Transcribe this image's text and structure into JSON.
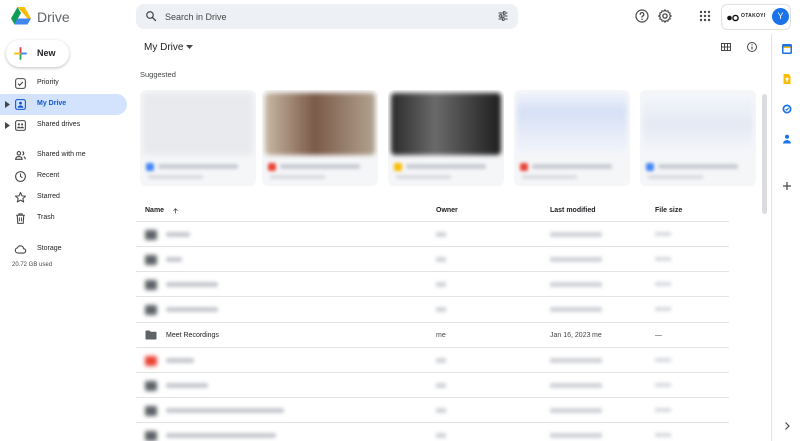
{
  "header": {
    "app_title": "Drive",
    "search_placeholder": "Search in Drive",
    "account_brand": "OTAKOYI",
    "avatar_initial": "Y"
  },
  "sidebar": {
    "new_label": "New",
    "items": [
      {
        "label": "Priority",
        "icon": "priority-icon"
      },
      {
        "label": "My Drive",
        "icon": "my-drive-icon",
        "active": true
      },
      {
        "label": "Shared drives",
        "icon": "shared-drives-icon"
      },
      {
        "label": "Shared with me",
        "icon": "shared-with-me-icon"
      },
      {
        "label": "Recent",
        "icon": "clock-icon"
      },
      {
        "label": "Starred",
        "icon": "star-icon"
      },
      {
        "label": "Trash",
        "icon": "trash-icon"
      },
      {
        "label": "Storage",
        "icon": "cloud-icon"
      }
    ],
    "storage_used": "20.72 GB used"
  },
  "main": {
    "breadcrumb": "My Drive",
    "suggested_label": "Suggested",
    "columns": [
      "Name",
      "Owner",
      "Last modified",
      "File size"
    ],
    "visible_row": {
      "name": "Meet Recordings",
      "owner": "me",
      "modified": "Jan 16, 2023",
      "modified_by": "me",
      "size": "—"
    }
  },
  "colors": {
    "accent": "#0b57d0",
    "active_nav_bg": "#d3e3fd",
    "search_bg": "#edf0f4",
    "avatar": "#1a73e8"
  }
}
